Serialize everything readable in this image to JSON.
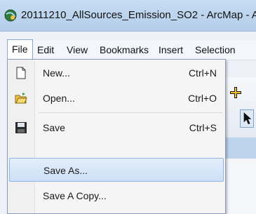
{
  "window": {
    "title": "20111210_AllSources_Emission_SO2 - ArcMap - A"
  },
  "menubar": {
    "items": [
      {
        "label": "File",
        "active": true
      },
      {
        "label": "Edit"
      },
      {
        "label": "View"
      },
      {
        "label": "Bookmarks"
      },
      {
        "label": "Insert"
      },
      {
        "label": "Selection"
      }
    ]
  },
  "file_menu": {
    "items": [
      {
        "label": "New...",
        "shortcut": "Ctrl+N",
        "icon": "new-document-icon"
      },
      {
        "label": "Open...",
        "shortcut": "Ctrl+O",
        "icon": "open-folder-icon"
      },
      {
        "label": "Save",
        "shortcut": "Ctrl+S",
        "icon": "save-disk-icon"
      },
      {
        "label": "Save As...",
        "shortcut": "",
        "highlighted": true
      },
      {
        "label": "Save A Copy...",
        "shortcut": ""
      }
    ]
  },
  "colors": {
    "highlight": "#cde0f6",
    "titlebar": "#c7dcf3"
  }
}
